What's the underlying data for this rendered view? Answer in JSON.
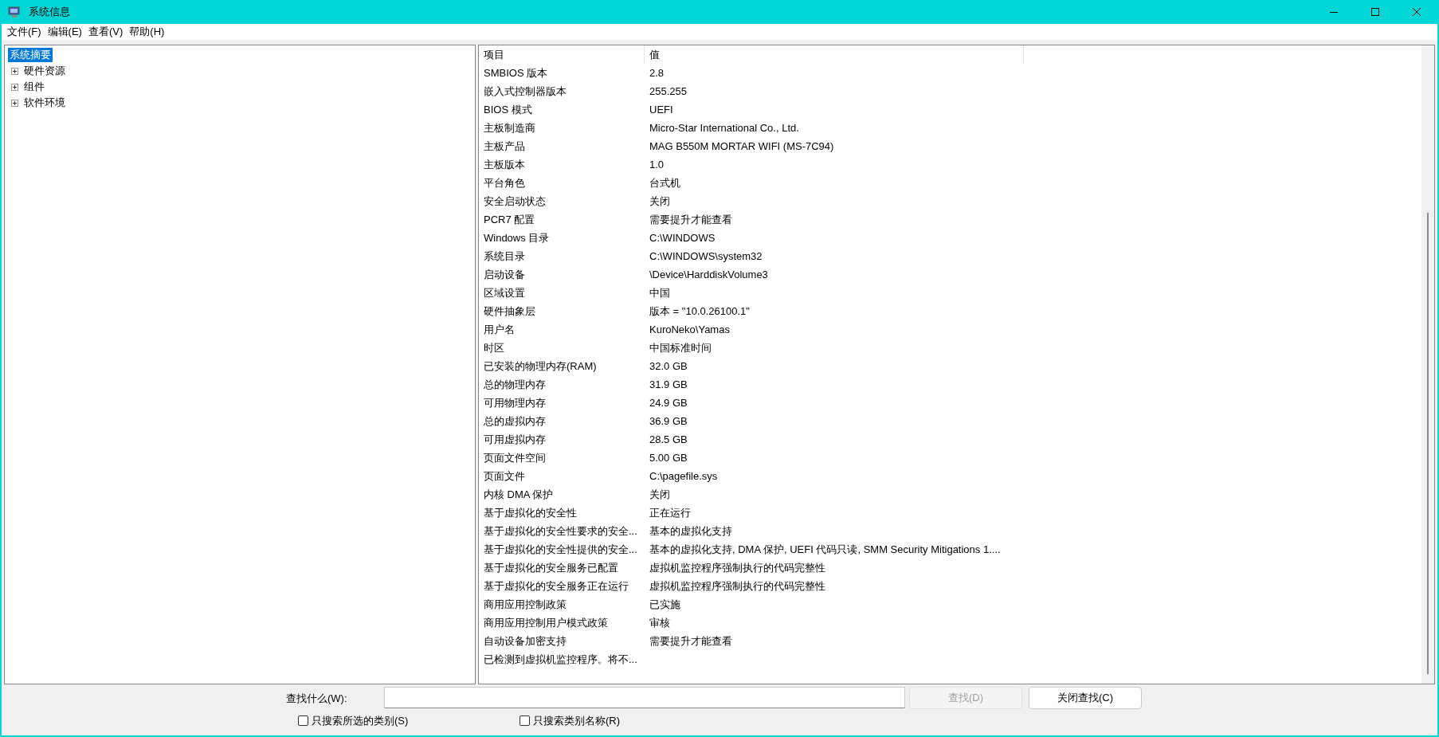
{
  "window": {
    "title": "系统信息"
  },
  "menu": [
    "文件(F)",
    "编辑(E)",
    "查看(V)",
    "帮助(H)"
  ],
  "tree": [
    {
      "label": "系统摘要",
      "selected": true,
      "expandable": false
    },
    {
      "label": "硬件资源",
      "selected": false,
      "expandable": true
    },
    {
      "label": "组件",
      "selected": false,
      "expandable": true
    },
    {
      "label": "软件环境",
      "selected": false,
      "expandable": true
    }
  ],
  "table": {
    "columns": [
      "项目",
      "值"
    ],
    "rows": [
      [
        "SMBIOS 版本",
        "2.8"
      ],
      [
        "嵌入式控制器版本",
        "255.255"
      ],
      [
        "BIOS 模式",
        "UEFI"
      ],
      [
        "主板制造商",
        "Micro-Star International Co., Ltd."
      ],
      [
        "主板产品",
        "MAG B550M MORTAR WIFI (MS-7C94)"
      ],
      [
        "主板版本",
        "1.0"
      ],
      [
        "平台角色",
        "台式机"
      ],
      [
        "安全启动状态",
        "关闭"
      ],
      [
        "PCR7 配置",
        "需要提升才能查看"
      ],
      [
        "Windows 目录",
        "C:\\WINDOWS"
      ],
      [
        "系统目录",
        "C:\\WINDOWS\\system32"
      ],
      [
        "启动设备",
        "\\Device\\HarddiskVolume3"
      ],
      [
        "区域设置",
        "中国"
      ],
      [
        "硬件抽象层",
        "版本 = \"10.0.26100.1\""
      ],
      [
        "用户名",
        "KuroNeko\\Yamas"
      ],
      [
        "时区",
        "中国标准时间"
      ],
      [
        "已安装的物理内存(RAM)",
        "32.0 GB"
      ],
      [
        "总的物理内存",
        "31.9 GB"
      ],
      [
        "可用物理内存",
        "24.9 GB"
      ],
      [
        "总的虚拟内存",
        "36.9 GB"
      ],
      [
        "可用虚拟内存",
        "28.5 GB"
      ],
      [
        "页面文件空间",
        "5.00 GB"
      ],
      [
        "页面文件",
        "C:\\pagefile.sys"
      ],
      [
        "内核 DMA 保护",
        "关闭"
      ],
      [
        "基于虚拟化的安全性",
        "正在运行"
      ],
      [
        "基于虚拟化的安全性要求的安全...",
        "基本的虚拟化支持"
      ],
      [
        "基于虚拟化的安全性提供的安全...",
        "基本的虚拟化支持, DMA 保护, UEFI 代码只读, SMM Security Mitigations 1...."
      ],
      [
        "基于虚拟化的安全服务已配置",
        "虚拟机监控程序强制执行的代码完整性"
      ],
      [
        "基于虚拟化的安全服务正在运行",
        "虚拟机监控程序强制执行的代码完整性"
      ],
      [
        "商用应用控制政策",
        "已实施"
      ],
      [
        "商用应用控制用户模式政策",
        "审核"
      ],
      [
        "自动设备加密支持",
        "需要提升才能查看"
      ],
      [
        "已检测到虚拟机监控程序。将不...",
        ""
      ]
    ]
  },
  "find": {
    "label": "查找什么(W):",
    "find_button": {
      "label": "查找(D)",
      "disabled": true
    },
    "close_button": "关闭查找(C)",
    "options": [
      {
        "label": "只搜索所选的类别(S)",
        "checked": false
      },
      {
        "label": "只搜索类别名称(R)",
        "checked": false
      }
    ]
  }
}
